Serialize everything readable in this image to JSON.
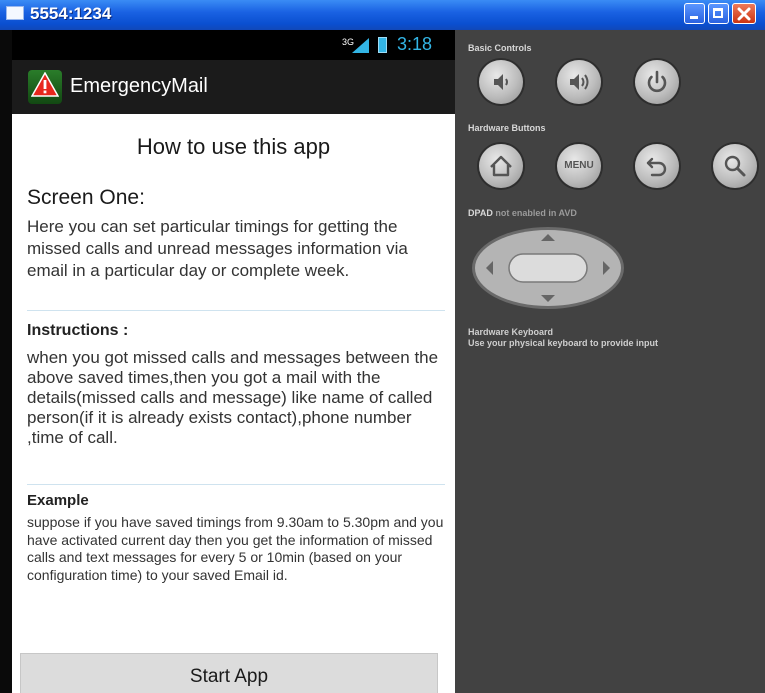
{
  "window": {
    "title": "5554:1234",
    "accent_color": "#1a62e3"
  },
  "status_bar": {
    "network": "3G",
    "time": "3:18",
    "time_color": "#33b5e5"
  },
  "action_bar": {
    "app_name": "EmergencyMail"
  },
  "content": {
    "heading": "How to use this app",
    "screen_one": {
      "title": "Screen One:",
      "text": "Here you can set particular timings for getting the missed calls and unread messages information via email in a particular day or complete week."
    },
    "instructions": {
      "title": "Instructions :",
      "text": "when you got missed calls and messages between the above saved times,then you got a mail with the details(missed calls and message) like name of called person(if it is already exists contact),phone number ,time of call."
    },
    "example": {
      "title": "Example",
      "text": "suppose if you have saved timings from 9.30am to 5.30pm and you have activated current day then you get the information of missed calls and text messages for every 5 or 10min (based on your configuration time) to your saved Email id."
    },
    "start_button": "Start App"
  },
  "panel": {
    "basic_controls_label": "Basic Controls",
    "hardware_buttons_label": "Hardware Buttons",
    "menu_label": "MENU",
    "dpad_label_prefix": "DPAD",
    "dpad_label_suffix": "not enabled in AVD",
    "keyboard_title": "Hardware Keyboard",
    "keyboard_text": "Use your physical keyboard to provide input",
    "background_color": "#424242"
  }
}
